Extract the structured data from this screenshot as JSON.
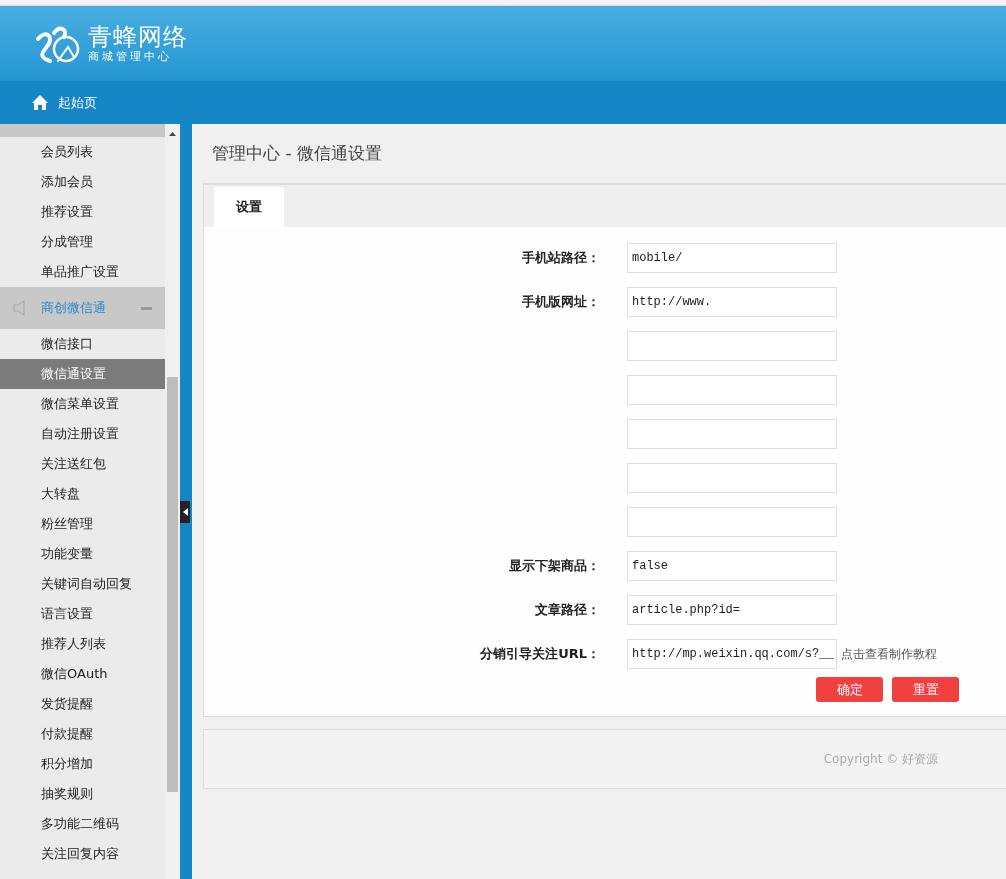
{
  "header": {
    "logo_title": "青蜂网络",
    "logo_subtitle": "商城管理中心"
  },
  "nav": {
    "home_label": "起始页"
  },
  "sidebar": {
    "items_above": [
      {
        "label": "会员列表",
        "selected": false
      },
      {
        "label": "添加会员",
        "selected": false
      },
      {
        "label": "推荐设置",
        "selected": false
      },
      {
        "label": "分成管理",
        "selected": false
      },
      {
        "label": "单品推广设置",
        "selected": false
      }
    ],
    "group": {
      "label": "商创微信通",
      "expanded": true,
      "items": [
        {
          "label": "微信接口",
          "selected": false
        },
        {
          "label": "微信通设置",
          "selected": true
        },
        {
          "label": "微信菜单设置",
          "selected": false
        },
        {
          "label": "自动注册设置",
          "selected": false
        },
        {
          "label": "关注送红包",
          "selected": false
        },
        {
          "label": "大转盘",
          "selected": false
        },
        {
          "label": "粉丝管理",
          "selected": false
        },
        {
          "label": "功能变量",
          "selected": false
        },
        {
          "label": "关键词自动回复",
          "selected": false
        },
        {
          "label": "语言设置",
          "selected": false
        },
        {
          "label": "推荐人列表",
          "selected": false
        },
        {
          "label": "微信OAuth",
          "selected": false
        },
        {
          "label": "发货提醒",
          "selected": false
        },
        {
          "label": "付款提醒",
          "selected": false
        },
        {
          "label": "积分增加",
          "selected": false
        },
        {
          "label": "抽奖规则",
          "selected": false
        },
        {
          "label": "多功能二维码",
          "selected": false
        },
        {
          "label": "关注回复内容",
          "selected": false
        }
      ]
    }
  },
  "main": {
    "title": "管理中心 - 微信通设置",
    "tabs": [
      {
        "label": "设置",
        "selected": true
      }
    ],
    "form": {
      "rows": [
        {
          "label": "手机站路径：",
          "value": "mobile/"
        },
        {
          "label": "手机版网址：",
          "value": "http://www."
        },
        {},
        {},
        {},
        {},
        {},
        {
          "label": "显示下架商品：",
          "value": "false"
        },
        {
          "label": "文章路径：",
          "value": "article.php?id="
        },
        {
          "label": "分销引导关注URL：",
          "value": "http://mp.weixin.qq.com/s?__",
          "note": "点击查看制作教程"
        }
      ],
      "buttons": [
        "确定",
        "重置"
      ]
    },
    "footer": {
      "copyright": "Copyright © 好资源"
    }
  }
}
